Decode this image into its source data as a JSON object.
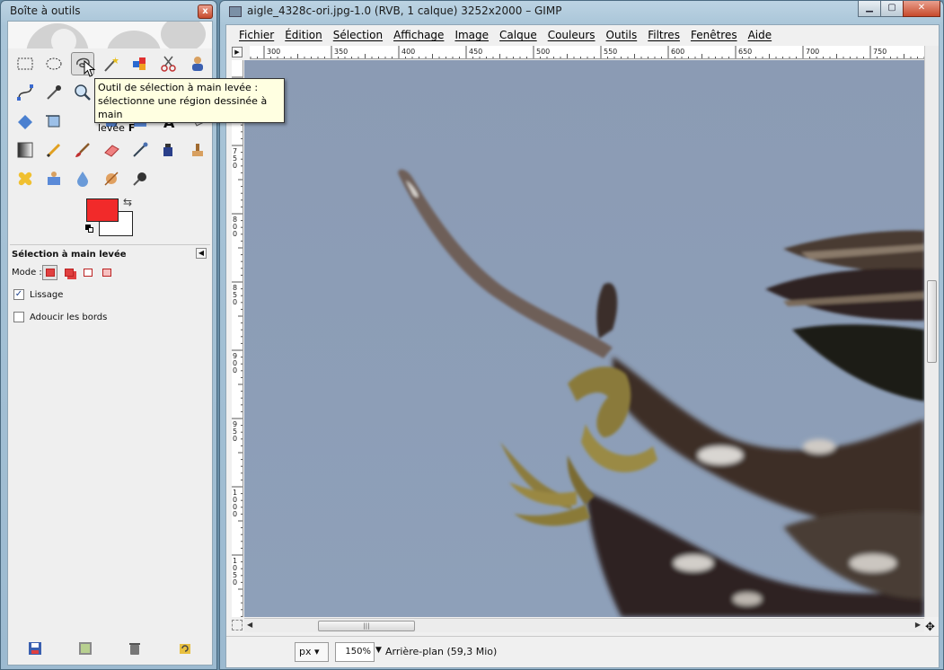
{
  "toolbox": {
    "title": "Boîte à outils",
    "close_label": "x",
    "tool_options": {
      "title": "Sélection à main levée",
      "mode_label": "Mode :",
      "antialias_label": "Lissage",
      "antialias_checked": true,
      "feather_label": "Adoucir les bords",
      "feather_checked": false
    },
    "foreground_color": "#f12a2a",
    "background_color": "#ffffff"
  },
  "tooltip": {
    "line1": "Outil de sélection à main levée :",
    "line2": "sélectionne une région dessinée à main",
    "line3": "levée",
    "shortcut": "F"
  },
  "image_window": {
    "title": "aigle_4328c-ori.jpg-1.0 (RVB, 1 calque) 3252x2000 – GIMP",
    "menus": [
      "Fichier",
      "Édition",
      "Sélection",
      "Affichage",
      "Image",
      "Calque",
      "Couleurs",
      "Outils",
      "Filtres",
      "Fenêtres",
      "Aide"
    ],
    "ruler_top_labels": [
      "300",
      "350",
      "400",
      "450",
      "500",
      "550",
      "600",
      "650",
      "700",
      "750"
    ],
    "ruler_left_labels": [
      "750",
      "800",
      "850",
      "900",
      "950",
      "1000",
      "1050"
    ],
    "unit": "px",
    "zoom": "150%",
    "status": "Arrière-plan (59,3 Mio)"
  }
}
